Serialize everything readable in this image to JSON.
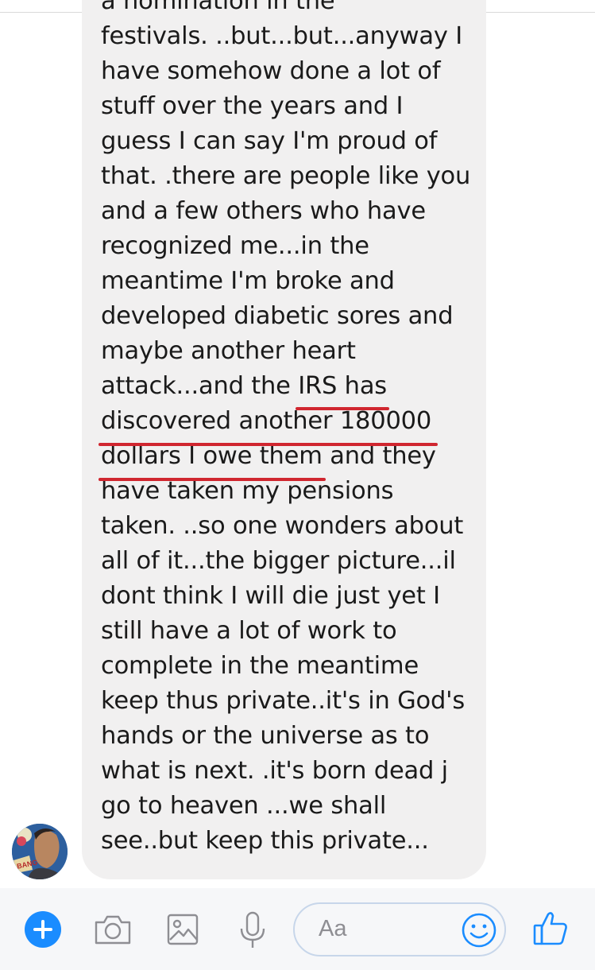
{
  "message": {
    "lines": [
      "a nomination in the",
      "festivals. ..but...but...anyway I",
      "have somehow done a lot of",
      "stuff over the years and I",
      "guess I can say I'm proud of",
      "that. .there are people like you",
      "and a few others who have",
      "recognized me...in the",
      "meantime I'm broke and",
      "developed diabetic sores and",
      "maybe another heart",
      "attack...and the IRS has",
      "discovered another 180000",
      "dollars I owe them and they",
      "have taken my pensions",
      "taken. ..so one wonders about",
      "all of it...the bigger picture...il",
      "dont think I will die just yet I",
      "still have a lot of work to",
      "complete in the meantime",
      "keep thus private..it's in God's",
      "hands or the universe as to",
      "what is next. .it's born dead j",
      "go to heaven ...we shall",
      "see..but keep this private..."
    ],
    "underline_color": "#d0262f"
  },
  "composer": {
    "placeholder": "Aa",
    "accent_color": "#1a8cff",
    "icons": [
      "plus-icon",
      "camera-icon",
      "image-icon",
      "microphone-icon",
      "emoji-icon",
      "thumbs-up-icon"
    ]
  },
  "avatar": {
    "badge_text": "BANG"
  }
}
